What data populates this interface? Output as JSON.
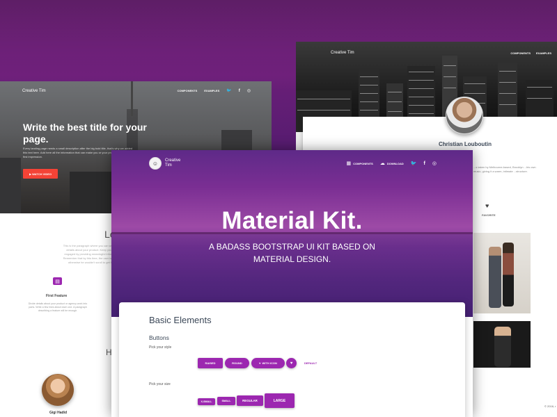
{
  "left_page": {
    "brand": "Creative Tim",
    "nav": [
      "COMPONENTS",
      "EXAMPLES"
    ],
    "title": "Write the best title for your page.",
    "description": "Every landing page needs a small description after the big bold title, that's why we added this text here. Add here all the information that can make you or your product create the first impression.",
    "watch_button": "▶ WATCH VIDEO",
    "section_title": "Le",
    "section_paragraph": "This is the paragraph where you can write more details about your product. Keep your user engaged by providing meaningful information. Remember that by this time, the user is curious, otherwise he wouldn't scroll to get here.",
    "feature_title": "First Feature",
    "feature_description": "Divide details about your product or agency work into parts. Write a few lines about each one. A paragraph describing a feature will be enough.",
    "section2_title": "H",
    "person_name": "Gigi Hadid"
  },
  "right_page": {
    "brand": "Creative Tim",
    "nav": [
      "COMPONENTS",
      "EXAMPLES"
    ],
    "profile_name": "Christian Louboutin",
    "bio": "...s taken by Melbourne-based, Brooklyn ...his own music, giving it a warm, intimate ...structure.",
    "favorite_label": "FAVORITE",
    "footer": "© 2016, r"
  },
  "center_page": {
    "brand": "Creative Tim",
    "nav": [
      {
        "icon": "apps-icon",
        "glyph": "▦",
        "label": "COMPONENTS"
      },
      {
        "icon": "cloud-download-icon",
        "glyph": "☁",
        "label": "DOWNLOAD"
      }
    ],
    "title": "Material Kit.",
    "subtitle_line1": "A BADASS BOOTSTRAP UI KIT BASED ON",
    "subtitle_line2": "MATERIAL DESIGN.",
    "section_title": "Basic Elements",
    "buttons_heading": "Buttons",
    "style_label": "Pick your style",
    "size_label": "Pick your size",
    "style_buttons": {
      "raised": "RAISED",
      "round": "ROUND",
      "with_icon": "WITH ICON",
      "default": "DEFAULT"
    },
    "size_buttons": {
      "xs": "X-SMALL",
      "sm": "SMALL",
      "md": "REGULAR",
      "lg": "LARGE"
    }
  },
  "colors": {
    "primary": "#9c27b0",
    "danger": "#f44336",
    "background": "#4c1a6c"
  }
}
